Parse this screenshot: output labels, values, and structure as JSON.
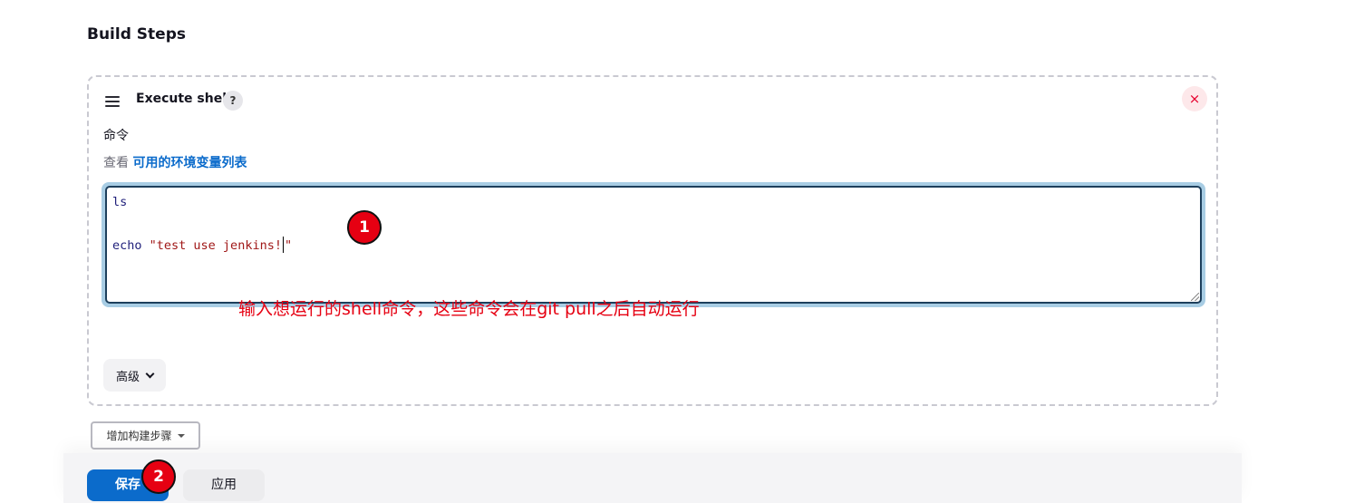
{
  "section": {
    "title": "Build Steps"
  },
  "step": {
    "title": "Execute shell",
    "help": "?",
    "close": "×",
    "field_label": "命令",
    "env_prefix": "查看",
    "env_link": "可用的环境变量列表",
    "code": {
      "line1": "ls",
      "line3_cmd": "echo",
      "line3_str_before_caret": "\"test use jenkins!",
      "line3_str_after_caret": "\""
    },
    "advanced": "高级"
  },
  "add_step": {
    "label": "增加构建步骤"
  },
  "footer": {
    "save": "保存",
    "apply": "应用"
  },
  "annotations": {
    "marker1": "1",
    "marker2": "2",
    "note": "输入想运行的shell命令，这些命令会在git pull之后自动运行",
    "note_color": "#e60012"
  },
  "colors": {
    "primary": "#0b6bcb",
    "danger": "#e6002e",
    "focus_ring": "#a8cde4"
  },
  "icons": {
    "drag": "drag-handle-icon",
    "help": "help-icon",
    "close": "close-icon",
    "advanced_chevron": "chevron-down-icon",
    "add_caret": "caret-down-icon"
  }
}
